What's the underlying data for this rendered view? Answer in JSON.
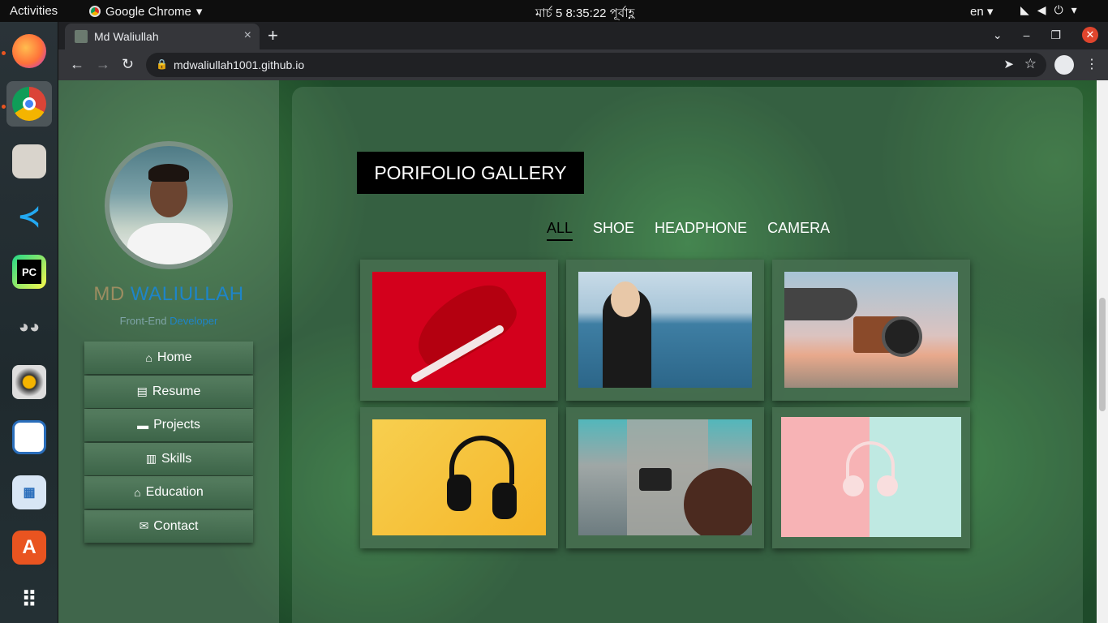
{
  "topbar": {
    "activities": "Activities",
    "app_name": "Google Chrome",
    "clock": "মার্চ 5  8:35:22 পূর্বাহ্ণ",
    "lang": "en"
  },
  "dock": {
    "items": [
      "firefox-icon",
      "chrome-icon",
      "files-icon",
      "vscode-icon",
      "pycharm-icon",
      "gimp-icon",
      "rhythmbox-icon",
      "writer-icon",
      "app-store-icon",
      "software-center-icon",
      "app-grid-icon"
    ]
  },
  "browser": {
    "tab_title": "Md Waliullah",
    "tab_close": "×",
    "new_tab": "+",
    "url": "mdwaliullah1001.github.io"
  },
  "page": {
    "name_first": "MD ",
    "name_last": "WALIULLAH",
    "role_a": "Front-End ",
    "role_b": "Developer",
    "menu": [
      {
        "label": "Home",
        "icon": "home-icon",
        "glyph": "⌂"
      },
      {
        "label": "Resume",
        "icon": "document-icon",
        "glyph": "▤"
      },
      {
        "label": "Projects",
        "icon": "folder-icon",
        "glyph": "▬"
      },
      {
        "label": "Skills",
        "icon": "bar-chart-icon",
        "glyph": "▥"
      },
      {
        "label": "Education",
        "icon": "graduation-cap-icon",
        "glyph": "⌂"
      },
      {
        "label": "Contact",
        "icon": "envelope-icon",
        "glyph": "✉"
      }
    ],
    "gallery_title": "PORIFOLIO GALLERY",
    "filters": [
      "ALL",
      "SHOE",
      "HEADPHONE",
      "CAMERA"
    ],
    "active_filter": "ALL",
    "gallery_items": [
      {
        "name": "red-sneaker-image",
        "category": "shoe"
      },
      {
        "name": "woman-headphones-sea-image",
        "category": "headphone"
      },
      {
        "name": "hand-holding-camera-image",
        "category": "camera"
      },
      {
        "name": "black-headphones-yellow-image",
        "category": "headphone"
      },
      {
        "name": "woman-camera-city-image",
        "category": "camera"
      },
      {
        "name": "pink-headphones-pastel-image",
        "category": "headphone"
      }
    ]
  }
}
